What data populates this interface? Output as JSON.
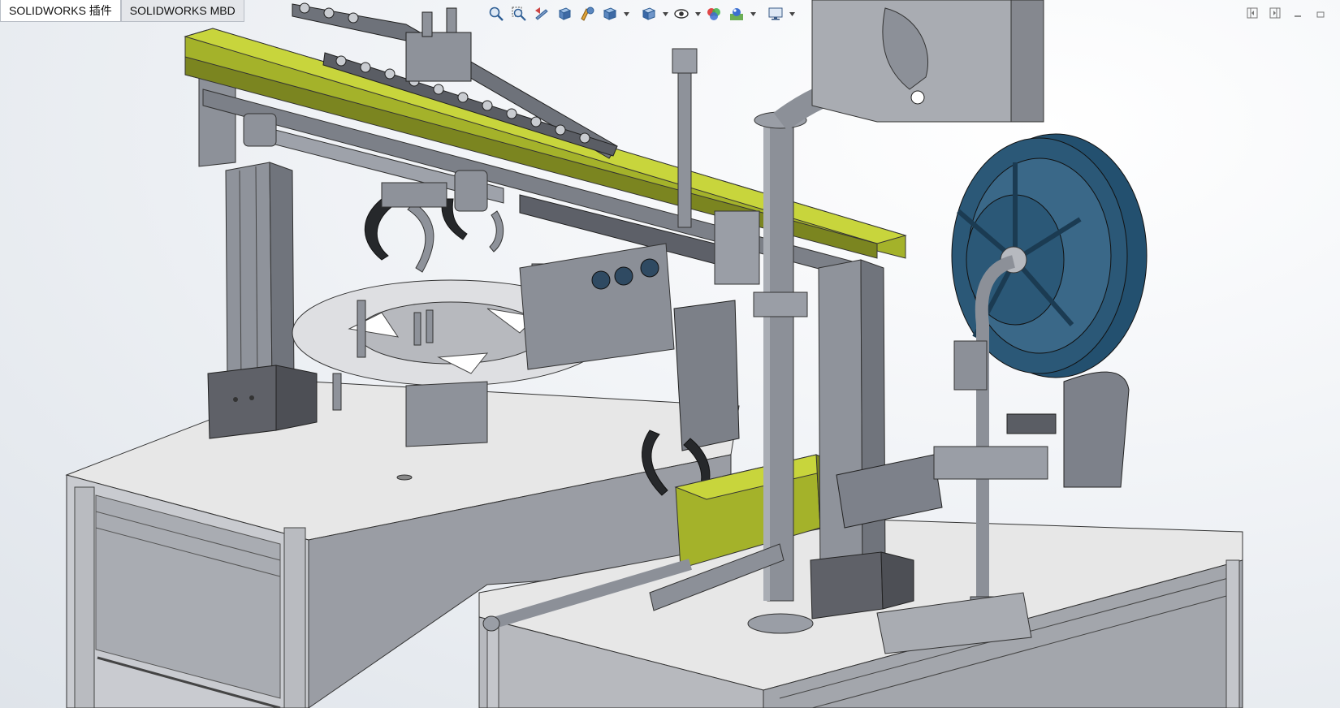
{
  "tabs": [
    {
      "label": "SOLIDWORKS 插件",
      "active": false
    },
    {
      "label": "SOLIDWORKS MBD",
      "active": true
    }
  ],
  "heads_up_toolbar": [
    "zoom-to-fit-icon",
    "zoom-to-area-icon",
    "previous-view-icon",
    "section-view-icon",
    "dynamic-annotation-icon",
    "view-orientation-icon",
    "display-style-icon",
    "hide-show-items-icon",
    "edit-appearance-icon",
    "apply-scene-icon",
    "view-settings-icon"
  ],
  "window_controls": [
    "tile-left-icon",
    "tile-right-icon",
    "minimize-icon",
    "close-icon"
  ],
  "colors": {
    "part_grey": "#8e939c",
    "part_dark": "#55585f",
    "table_top": "#e6e6e6",
    "highlight_yellow": "#a7b52e",
    "spool_blue": "#2b5877",
    "gripper_black": "#26282b"
  }
}
